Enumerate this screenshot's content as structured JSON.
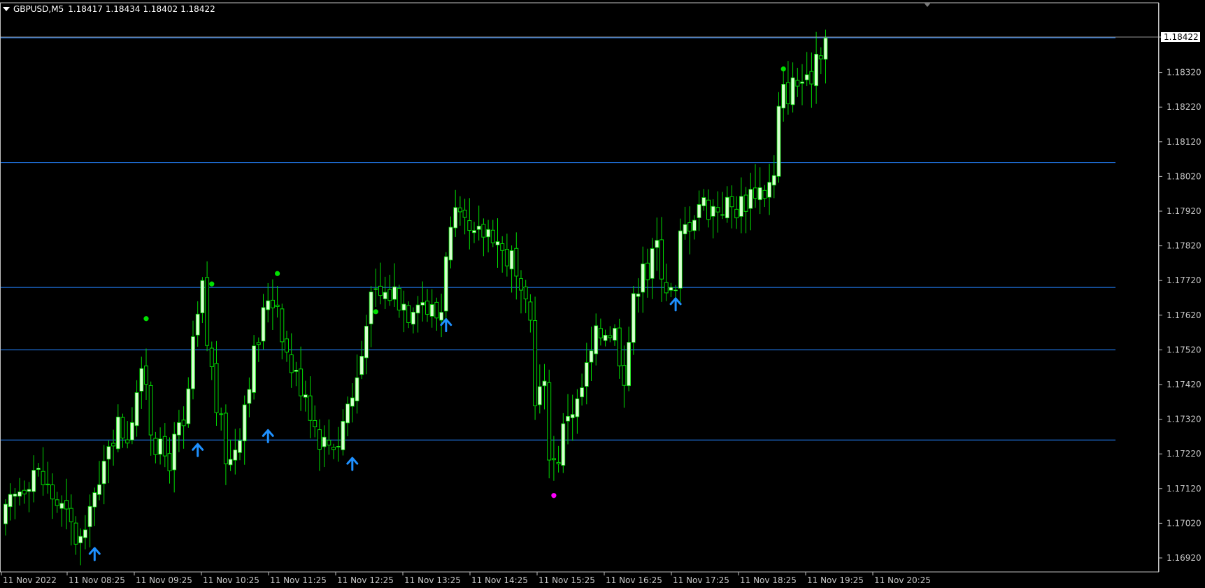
{
  "header": {
    "symbol": "GBPUSD,M5",
    "open": "1.18417",
    "high": "1.18434",
    "low": "1.18402",
    "close": "1.18422"
  },
  "colors": {
    "background": "#000000",
    "candle": "#00d800",
    "bull_body": "#ffffff",
    "bull_fill": "#d8ffd0",
    "grid_axis": "#c0c0c0",
    "level_line": "#1e6fd9",
    "up_arrow": "#1e90ff",
    "swing_high_dot": "#00e000",
    "swing_low_dot": "#ff00ff",
    "axis_text": "#c8c8c8",
    "price_label_bg": "#000000"
  },
  "price_axis": {
    "labels": [
      "1.18422",
      "1.18320",
      "1.18220",
      "1.18120",
      "1.18020",
      "1.17920",
      "1.17820",
      "1.17720",
      "1.17620",
      "1.17520",
      "1.17420",
      "1.17320",
      "1.17220",
      "1.17120",
      "1.17020",
      "1.16920"
    ],
    "current_price": "1.18422",
    "min": 1.1688,
    "max": 1.1847
  },
  "time_axis": {
    "labels": [
      "11 Nov 2022",
      "11 Nov 08:25",
      "11 Nov 09:25",
      "11 Nov 10:25",
      "11 Nov 11:25",
      "11 Nov 12:25",
      "11 Nov 13:25",
      "11 Nov 14:25",
      "11 Nov 15:25",
      "11 Nov 16:25",
      "11 Nov 17:25",
      "11 Nov 18:25",
      "11 Nov 19:25",
      "11 Nov 20:25"
    ]
  },
  "chart_data": {
    "type": "candlestick",
    "timeframe": "M5",
    "symbol": "GBPUSD",
    "horizontal_levels": [
      1.1842,
      1.1806,
      1.177,
      1.1752,
      1.1726
    ],
    "close_path": [
      [
        0,
        1.1704
      ],
      [
        3,
        1.1712
      ],
      [
        6,
        1.1718
      ],
      [
        9,
        1.1712
      ],
      [
        12,
        1.1706
      ],
      [
        15,
        1.1698
      ],
      [
        17,
        1.1696
      ],
      [
        18,
        1.1711
      ],
      [
        20,
        1.171
      ],
      [
        22,
        1.1727
      ],
      [
        24,
        1.173
      ],
      [
        26,
        1.1728
      ],
      [
        28,
        1.1741
      ],
      [
        30,
        1.1744
      ],
      [
        31,
        1.173
      ],
      [
        33,
        1.1722
      ],
      [
        35,
        1.1721
      ],
      [
        37,
        1.1728
      ],
      [
        38,
        1.1728
      ],
      [
        40,
        1.1752
      ],
      [
        42,
        1.1769
      ],
      [
        43,
        1.1754
      ],
      [
        44,
        1.1746
      ],
      [
        45,
        1.1736
      ],
      [
        47,
        1.1722
      ],
      [
        48,
        1.172
      ],
      [
        50,
        1.173
      ],
      [
        52,
        1.1745
      ],
      [
        54,
        1.1755
      ],
      [
        56,
        1.1768
      ],
      [
        58,
        1.1766
      ],
      [
        60,
        1.1751
      ],
      [
        62,
        1.1744
      ],
      [
        64,
        1.1741
      ],
      [
        66,
        1.173
      ],
      [
        68,
        1.1725
      ],
      [
        70,
        1.1726
      ],
      [
        71,
        1.1726
      ],
      [
        73,
        1.1737
      ],
      [
        74,
        1.1738
      ],
      [
        76,
        1.1751
      ],
      [
        77,
        1.1763
      ],
      [
        79,
        1.1767
      ],
      [
        81,
        1.1768
      ],
      [
        83,
        1.1769
      ],
      [
        86,
        1.1764
      ],
      [
        88,
        1.1769
      ],
      [
        90,
        1.1764
      ],
      [
        92,
        1.1762
      ],
      [
        93,
        1.1764
      ],
      [
        94,
        1.1782
      ],
      [
        96,
        1.1789
      ],
      [
        98,
        1.1786
      ],
      [
        100,
        1.1783
      ],
      [
        102,
        1.1786
      ],
      [
        104,
        1.1787
      ],
      [
        106,
        1.178
      ],
      [
        108,
        1.1778
      ],
      [
        110,
        1.1765
      ],
      [
        112,
        1.176
      ],
      [
        113,
        1.174
      ],
      [
        115,
        1.174
      ],
      [
        116,
        1.1724
      ],
      [
        117,
        1.172
      ],
      [
        118,
        1.1722
      ],
      [
        120,
        1.1735
      ],
      [
        122,
        1.1736
      ],
      [
        124,
        1.1746
      ],
      [
        126,
        1.1755
      ],
      [
        127,
        1.1757
      ],
      [
        128,
        1.1759
      ],
      [
        130,
        1.1757
      ],
      [
        132,
        1.1746
      ],
      [
        134,
        1.1765
      ],
      [
        136,
        1.178
      ],
      [
        137,
        1.1774
      ],
      [
        139,
        1.1782
      ],
      [
        141,
        1.1771
      ],
      [
        143,
        1.1767
      ],
      [
        144,
        1.1784
      ],
      [
        146,
        1.179
      ],
      [
        148,
        1.1795
      ],
      [
        149,
        1.1794
      ],
      [
        151,
        1.1793
      ],
      [
        153,
        1.1794
      ],
      [
        155,
        1.1793
      ],
      [
        157,
        1.1794
      ],
      [
        158,
        1.1796
      ],
      [
        160,
        1.1799
      ],
      [
        162,
        1.1798
      ],
      [
        164,
        1.1801
      ],
      [
        165,
        1.182
      ],
      [
        166,
        1.1826
      ],
      [
        168,
        1.1828
      ],
      [
        170,
        1.183
      ],
      [
        171,
        1.1827
      ],
      [
        173,
        1.1838
      ],
      [
        174,
        1.184
      ],
      [
        175,
        1.1842
      ]
    ],
    "signals": {
      "up_arrows": [
        [
          19,
          1.1693
        ],
        [
          41,
          1.1723
        ],
        [
          56,
          1.1727
        ],
        [
          74,
          1.1719
        ],
        [
          94,
          1.1759
        ],
        [
          143,
          1.1765
        ]
      ],
      "swing_highs": [
        [
          30,
          1.1761
        ],
        [
          44,
          1.1771
        ],
        [
          58,
          1.1774
        ],
        [
          79,
          1.1763
        ],
        [
          166,
          1.1833
        ]
      ],
      "swing_lows": [
        [
          117,
          1.171
        ]
      ]
    }
  }
}
